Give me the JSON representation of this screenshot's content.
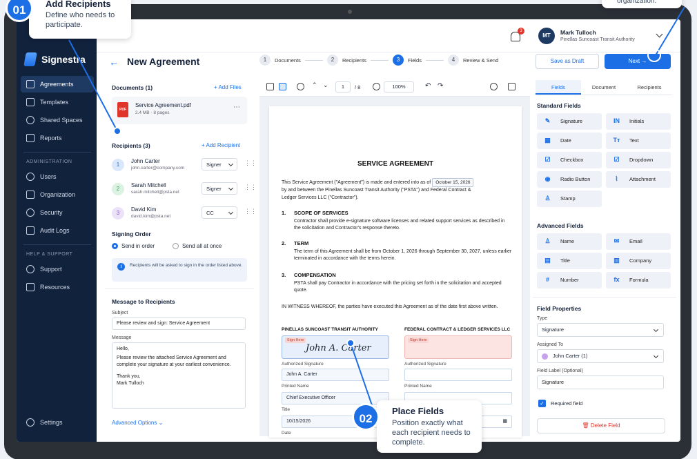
{
  "app": {
    "name": "Signestra"
  },
  "sidebar": {
    "items": [
      {
        "label": "Agreements",
        "icon": "document-icon",
        "active": true
      },
      {
        "label": "Templates",
        "icon": "template-icon"
      },
      {
        "label": "Shared Spaces",
        "icon": "people-icon"
      },
      {
        "label": "Reports",
        "icon": "chart-icon"
      }
    ],
    "admin_heading": "ADMINISTRATION",
    "admin_items": [
      {
        "label": "Users",
        "icon": "user-icon"
      },
      {
        "label": "Organization",
        "icon": "building-icon"
      },
      {
        "label": "Security",
        "icon": "shield-icon"
      },
      {
        "label": "Audit Logs",
        "icon": "log-icon"
      }
    ],
    "help_heading": "HELP & SUPPORT",
    "help_items": [
      {
        "label": "Support",
        "icon": "help-icon"
      },
      {
        "label": "Resources",
        "icon": "book-icon"
      }
    ],
    "settings_label": "Settings"
  },
  "topbar": {
    "notification_count": "3",
    "user_initials": "MT",
    "user_name": "Mark Tulloch",
    "user_org": "Pinellas Suncoast Transit Authority"
  },
  "header": {
    "title": "New Agreement",
    "steps": [
      {
        "num": "1",
        "label": "Documents"
      },
      {
        "num": "2",
        "label": "Recipients"
      },
      {
        "num": "3",
        "label": "Fields",
        "active": true
      },
      {
        "num": "4",
        "label": "Review & Send"
      }
    ],
    "save_draft": "Save as Draft",
    "next": "Next →"
  },
  "documents": {
    "title": "Documents (1)",
    "add": "+ Add Files",
    "file_name": "Service Agreement.pdf",
    "file_meta": "2.4 MB · 8 pages",
    "file_type": "PDF"
  },
  "recipients": {
    "title": "Recipients (3)",
    "add": "+ Add Recipient",
    "list": [
      {
        "num": "1",
        "name": "John Carter",
        "email": "john.carter@company.com",
        "role": "Signer",
        "color": "#dbe8fb",
        "text": "#1d6fe6"
      },
      {
        "num": "2",
        "name": "Sarah Mitchell",
        "email": "sarah.mitchell@psta.net",
        "role": "Signer",
        "color": "#dcf3e3",
        "text": "#2f9a57"
      },
      {
        "num": "3",
        "name": "David Kim",
        "email": "david.kim@psta.net",
        "role": "CC",
        "color": "#ece2f8",
        "text": "#8b53c9"
      }
    ]
  },
  "signing_order": {
    "title": "Signing Order",
    "opt1": "Send in order",
    "opt2": "Send all at once",
    "info": "Recipients will be asked to sign in the order listed above."
  },
  "message": {
    "title": "Message to Recipients",
    "subject_label": "Subject",
    "subject_value": "Please review and sign: Service Agreement",
    "message_label": "Message",
    "line1": "Hello,",
    "line2": "Please review the attached Service Agreement and complete your signature at your earliest convenience.",
    "line3": "Thank you,",
    "line4": "Mark Tulloch",
    "advanced": "Advanced Options"
  },
  "viewer": {
    "page": "1",
    "page_total": "/ 8",
    "zoom": "100%"
  },
  "document": {
    "title": "SERVICE AGREEMENT",
    "intro_a": "This Service Agreement (\"Agreement\") is made and entered into as of",
    "intro_date": "October 15, 2026",
    "intro_b": "by and between the Pinellas Suncoast Transit Authority (\"PSTA\") and Federal Contract &",
    "intro_c": "Ledger Services LLC (\"Contractor\").",
    "s1_num": "1.",
    "s1_head": "SCOPE OF SERVICES",
    "s1_text": "Contractor shall provide e-signature software licenses and related support services as described in the solicitation and Contractor's response thereto.",
    "s2_num": "2.",
    "s2_head": "TERM",
    "s2_text": "The term of this Agreement shall be from October 1, 2026 through September 30, 2027, unless earlier terminated in accordance with the terms herein.",
    "s3_num": "3.",
    "s3_head": "COMPENSATION",
    "s3_text": "PSTA shall pay Contractor in accordance with the pricing set forth in the solicitation and accepted quote.",
    "witness": "IN WITNESS WHEREOF,  the parties have executed this Agreement as of the date first above written.",
    "party1": "PINELLAS SUNCOAST TRANSIT AUTHORITY",
    "party2": "FEDERAL CONTRACT & LEDGER SERVICES LLC",
    "sign_here": "Sign Here",
    "signature": "John A. Carter",
    "auth_sig": "Authorized Signature",
    "printed_value": "John A. Carter",
    "printed_name": "Printed Name",
    "title_value": "Chief Executive Officer",
    "title_label": "Title",
    "date_value": "10/15/2026",
    "date_label": "Date"
  },
  "right": {
    "tabs": [
      "Fields",
      "Document",
      "Recipients"
    ],
    "standard_title": "Standard Fields",
    "standard": [
      {
        "label": "Signature",
        "glyph": "✎"
      },
      {
        "label": "Initials",
        "glyph": "IN"
      },
      {
        "label": "Date",
        "glyph": "▦"
      },
      {
        "label": "Text",
        "glyph": "Tт"
      },
      {
        "label": "Checkbox",
        "glyph": "☑"
      },
      {
        "label": "Dropdown",
        "glyph": "☑"
      },
      {
        "label": "Radio Button",
        "glyph": "◉"
      },
      {
        "label": "Attachment",
        "glyph": "⌇"
      },
      {
        "label": "Stamp",
        "glyph": "♙"
      }
    ],
    "advanced_title": "Advanced Fields",
    "advanced": [
      {
        "label": "Name",
        "glyph": "♙"
      },
      {
        "label": "Email",
        "glyph": "✉"
      },
      {
        "label": "Title",
        "glyph": "▤"
      },
      {
        "label": "Company",
        "glyph": "▥"
      },
      {
        "label": "Number",
        "glyph": "#"
      },
      {
        "label": "Formula",
        "glyph": "fx"
      }
    ],
    "props_title": "Field Properties",
    "type_label": "Type",
    "type_value": "Signature",
    "assigned_label": "Assigned To",
    "assigned_value": "John Carter (1)",
    "field_label": "Field Label (Optional)",
    "field_value": "Signature",
    "required": "Required field",
    "delete": "Delete Field"
  },
  "callouts": {
    "c1_num": "01",
    "c1_title": "Add Recipients",
    "c1_text": "Define who needs to participate.",
    "c2_num": "02",
    "c2_title": "Place Fields",
    "c2_text": "Position exactly what each recipient needs to complete.",
    "c3_text": "organization."
  }
}
